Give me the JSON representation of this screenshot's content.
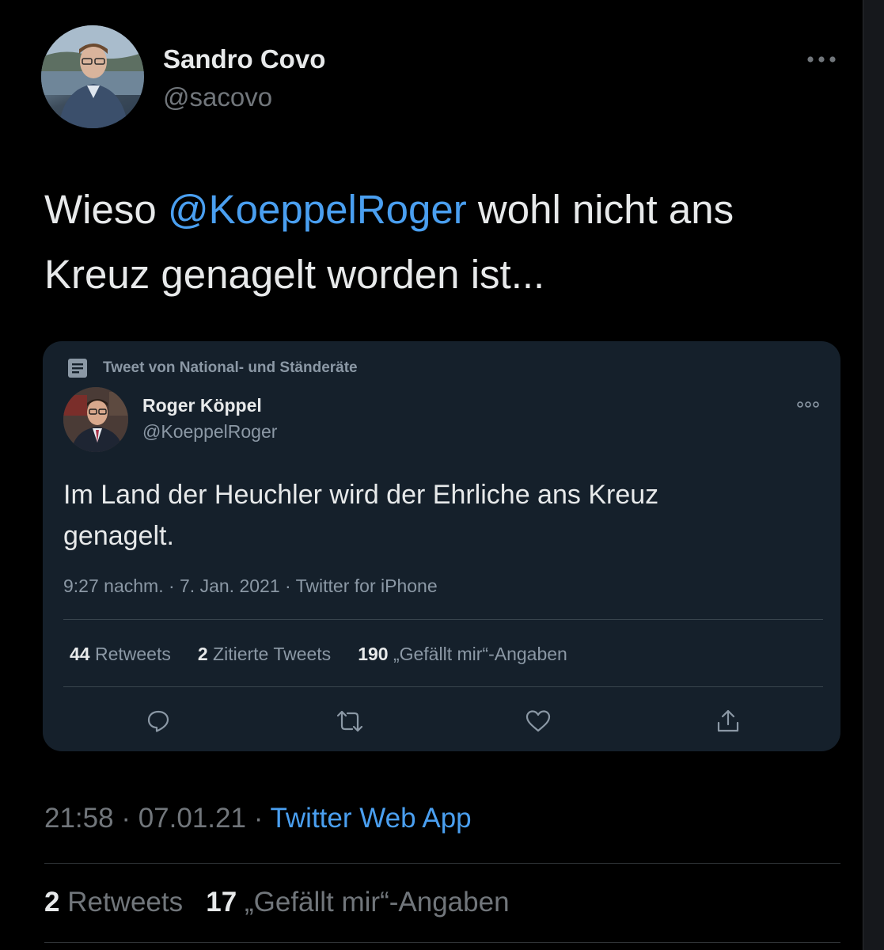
{
  "tweet": {
    "author_name": "Sandro Covo",
    "author_handle": "@sacovo",
    "text_before": "Wieso ",
    "mention": "@KoeppelRoger",
    "text_after": " wohl nicht ans Kreuz genagelt worden ist...",
    "time": "21:58",
    "date": "07.01.21",
    "separator": "·",
    "source": "Twitter Web App",
    "retweets_count": "2",
    "retweets_label": "Retweets",
    "likes_count": "17",
    "likes_label": "„Gefällt mir“-Angaben"
  },
  "quoted": {
    "source_label": "Tweet von National- und Ständeräte",
    "author_name": "Roger Köppel",
    "author_handle": "@KoeppelRoger",
    "text": "Im Land der Heuchler wird der Ehrliche ans Kreuz genagelt.",
    "meta": "9:27 nachm. · 7. Jan. 2021 · Twitter for iPhone",
    "retweets_count": "44",
    "retweets_label": "Retweets",
    "quotes_count": "2",
    "quotes_label": "Zitierte Tweets",
    "likes_count": "190",
    "likes_label": "„Gefällt mir“-Angaben"
  },
  "icons": {
    "more": "more-horizontal-icon",
    "document": "document-icon",
    "reply": "reply-icon",
    "retweet": "retweet-icon",
    "like": "heart-icon",
    "share": "share-icon"
  },
  "colors": {
    "background": "#000000",
    "card_background": "#15202b",
    "accent": "#4a9ff0",
    "primary_text": "#e7e9ea",
    "secondary_text": "#71767b"
  }
}
